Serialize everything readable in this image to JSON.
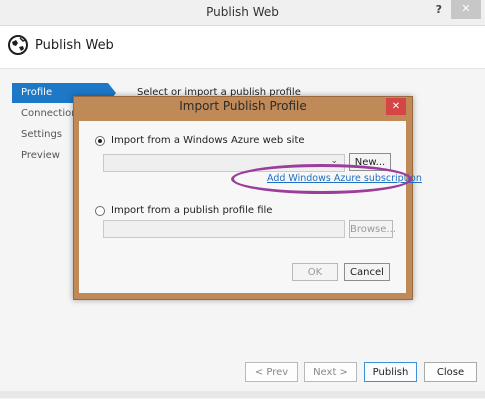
{
  "window": {
    "title": "Publish Web",
    "help_icon": "?",
    "close_icon": "✕"
  },
  "header": {
    "icon": "globe-icon",
    "title": "Publish Web"
  },
  "sidebar": {
    "items": [
      {
        "label": "Profile",
        "active": true
      },
      {
        "label": "Connection",
        "active": false
      },
      {
        "label": "Settings",
        "active": false
      },
      {
        "label": "Preview",
        "active": false
      }
    ]
  },
  "main": {
    "select_label": "Select or import a publish profile"
  },
  "dialog": {
    "title": "Import Publish Profile",
    "close_icon": "✕",
    "option_azure": "Import from a Windows Azure web site",
    "azure_selected": true,
    "combo_arrow": "⌄",
    "new_button": "New...",
    "add_subscription_link": "Add Windows Azure subscription",
    "option_file": "Import from a publish profile file",
    "file_selected": false,
    "browse_button": "Browse...",
    "ok_button": "OK",
    "cancel_button": "Cancel"
  },
  "footer": {
    "prev_button": "< Prev",
    "next_button": "Next >",
    "publish_button": "Publish",
    "close_button": "Close"
  },
  "colors": {
    "accent": "#1e78c8",
    "dialog_frame": "#c08a58",
    "link": "#1f6fc5",
    "annotation_oval": "#9b3d9b"
  }
}
